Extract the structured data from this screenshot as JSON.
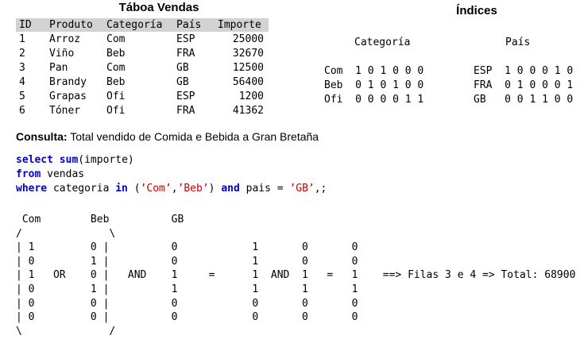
{
  "table": {
    "title": "Táboa Vendas",
    "headers": [
      "ID",
      "Produto",
      "Categoría",
      "País",
      "Importe"
    ],
    "rows": [
      [
        "1",
        "Arroz",
        "Com",
        "ESP",
        "25000"
      ],
      [
        "2",
        "Viño",
        "Beb",
        "FRA",
        "32670"
      ],
      [
        "3",
        "Pan",
        "Com",
        "GB",
        "12500"
      ],
      [
        "4",
        "Brandy",
        "Beb",
        "GB",
        "56400"
      ],
      [
        "5",
        "Grapas",
        "Ofi",
        "ESP",
        "1200"
      ],
      [
        "6",
        "Tóner",
        "Ofi",
        "FRA",
        "41362"
      ]
    ]
  },
  "indices": {
    "title": "Índices",
    "categoria_header": "Categoría",
    "pais_header": "País",
    "categoria": [
      {
        "label": "Com",
        "bits": "1 0 1 0 0 0"
      },
      {
        "label": "Beb",
        "bits": "0 1 0 1 0 0"
      },
      {
        "label": "Ofi",
        "bits": "0 0 0 0 1 1"
      }
    ],
    "pais": [
      {
        "label": "ESP",
        "bits": "1 0 0 0 1 0"
      },
      {
        "label": "FRA",
        "bits": "0 1 0 0 0 1"
      },
      {
        "label": "GB",
        "bits": "0 0 1 1 0 0"
      }
    ]
  },
  "query": {
    "label": "Consulta:",
    "text": "Total vendido de Comida e Bebida a Gran Bretaña"
  },
  "sql": {
    "kw_select": "select",
    "kw_sum": "sum",
    "select_rest": "(importe)",
    "kw_from": "from",
    "from_rest": " vendas",
    "kw_where": "where",
    "where_1": " categoria ",
    "kw_in": "in",
    "where_2": " (",
    "str_com": "’Com’",
    "comma": ",",
    "str_beb": "’Beb’",
    "where_3": ") ",
    "kw_and": "and",
    "where_4": " pais = ",
    "str_gb": "’GB’",
    "where_5": ",;"
  },
  "calc": {
    "lines": [
      " Com        Beb          GB",
      "/              \\",
      "| 1         0 |          0            1       0       0",
      "| 0         1 |          0            1       0       0",
      "| 1   OR    0 |   AND    1     =      1  AND  1   =   1    ==> Filas 3 e 4 => Total: 68900",
      "| 0         1 |          1            1       1       1",
      "| 0         0 |          0            0       0       0",
      "| 0         0 |          0            0       0       0",
      "\\              /"
    ]
  }
}
